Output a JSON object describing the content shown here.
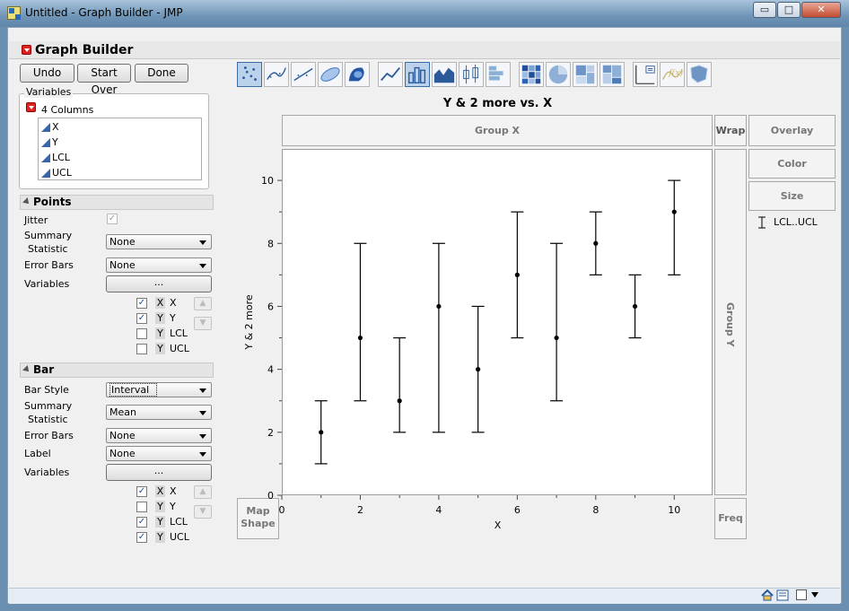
{
  "window": {
    "title": "Untitled - Graph Builder - JMP",
    "minimize": "▭",
    "maximize": "□",
    "close": "✕"
  },
  "header": {
    "title": "Graph Builder"
  },
  "buttons": {
    "undo": "Undo",
    "start_over": "Start Over",
    "done": "Done"
  },
  "variables": {
    "legend": "Variables",
    "count": "4 Columns",
    "columns": [
      "X",
      "Y",
      "LCL",
      "UCL"
    ]
  },
  "points": {
    "header": "Points",
    "jitter_label": "Jitter",
    "summary_label_1": "Summary",
    "summary_label_2": "Statistic",
    "summary_value": "None",
    "error_bars_label": "Error Bars",
    "error_bars_value": "None",
    "variables_label": "Variables",
    "variables_button": "...",
    "rows": [
      {
        "checked": true,
        "role": "X",
        "name": "X"
      },
      {
        "checked": true,
        "role": "Y",
        "name": "Y"
      },
      {
        "checked": false,
        "role": "Y",
        "name": "LCL"
      },
      {
        "checked": false,
        "role": "Y",
        "name": "UCL"
      }
    ]
  },
  "bar": {
    "header": "Bar",
    "style_label": "Bar Style",
    "style_value": "Interval",
    "summary_label_1": "Summary",
    "summary_label_2": "Statistic",
    "summary_value": "Mean",
    "error_bars_label": "Error Bars",
    "error_bars_value": "None",
    "label_label": "Label",
    "label_value": "None",
    "variables_label": "Variables",
    "variables_button": "...",
    "rows": [
      {
        "checked": true,
        "role": "X",
        "name": "X"
      },
      {
        "checked": false,
        "role": "Y",
        "name": "Y"
      },
      {
        "checked": true,
        "role": "Y",
        "name": "LCL"
      },
      {
        "checked": true,
        "role": "Y",
        "name": "UCL"
      }
    ]
  },
  "zones": {
    "group_x": "Group X",
    "wrap": "Wrap",
    "overlay": "Overlay",
    "color": "Color",
    "size": "Size",
    "group_y": "Group Y",
    "freq": "Freq",
    "map_shape_1": "Map",
    "map_shape_2": "Shape"
  },
  "legend": {
    "item": "LCL..UCL"
  },
  "chart_data": {
    "type": "scatter",
    "title": "Y & 2 more vs. X",
    "xlabel": "X",
    "ylabel": "Y & 2 more",
    "xlim": [
      0,
      11
    ],
    "ylim": [
      0,
      11
    ],
    "xticks": [
      0,
      2,
      4,
      6,
      8,
      10
    ],
    "yticks": [
      0,
      2,
      4,
      6,
      8,
      10
    ],
    "grid": false,
    "points": [
      {
        "x": 1,
        "y": 2,
        "lcl": 1,
        "ucl": 3
      },
      {
        "x": 2,
        "y": 5,
        "lcl": 3,
        "ucl": 8
      },
      {
        "x": 3,
        "y": 3,
        "lcl": 2,
        "ucl": 5
      },
      {
        "x": 4,
        "y": 6,
        "lcl": 2,
        "ucl": 8
      },
      {
        "x": 5,
        "y": 4,
        "lcl": 2,
        "ucl": 6
      },
      {
        "x": 6,
        "y": 7,
        "lcl": 5,
        "ucl": 9
      },
      {
        "x": 7,
        "y": 5,
        "lcl": 3,
        "ucl": 8
      },
      {
        "x": 8,
        "y": 8,
        "lcl": 7,
        "ucl": 9
      },
      {
        "x": 9,
        "y": 6,
        "lcl": 5,
        "ucl": 7
      },
      {
        "x": 10,
        "y": 9,
        "lcl": 7,
        "ucl": 10
      }
    ]
  },
  "toolbar": {
    "icons": [
      "points-icon",
      "smoother-icon",
      "line-of-fit-icon",
      "ellipse-icon",
      "contour-icon",
      "line-icon",
      "bar-icon",
      "area-icon",
      "box-plot-icon",
      "histogram-icon",
      "heatmap-icon",
      "pie-icon",
      "treemap-icon",
      "mosaic-icon",
      "caption-box-icon",
      "formula-icon",
      "map-shapes-icon"
    ],
    "selected": [
      "points-icon",
      "bar-icon"
    ]
  },
  "colors": {
    "selected_tool": "#bcd2ea",
    "accent": "#3b6ea5"
  }
}
